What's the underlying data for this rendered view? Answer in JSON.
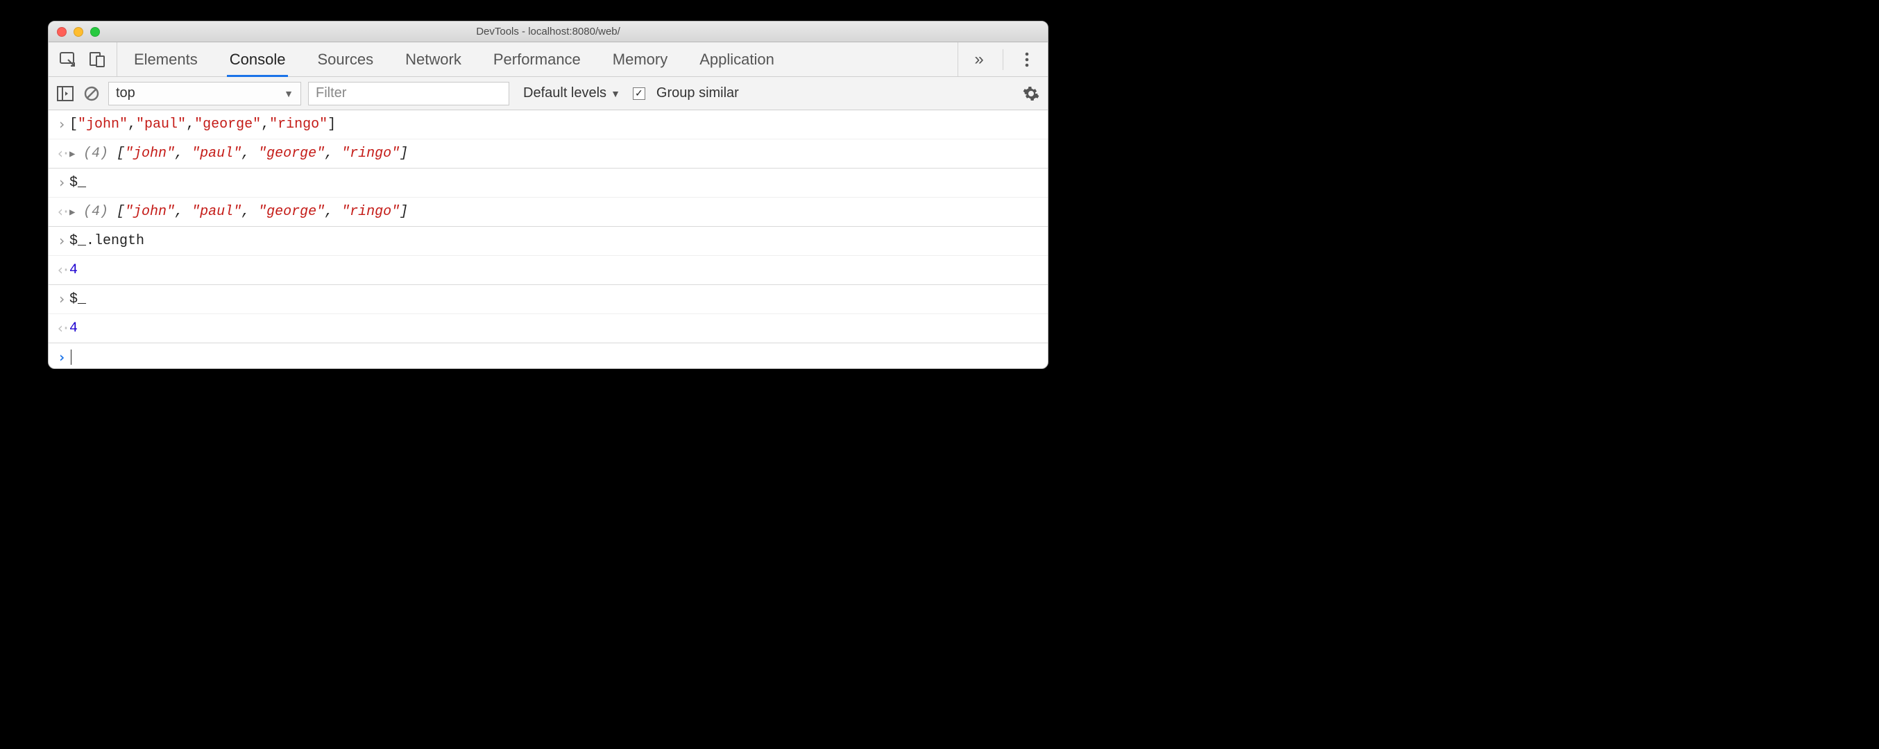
{
  "window": {
    "title": "DevTools - localhost:8080/web/"
  },
  "tabs": {
    "items": [
      {
        "label": "Elements"
      },
      {
        "label": "Console"
      },
      {
        "label": "Sources"
      },
      {
        "label": "Network"
      },
      {
        "label": "Performance"
      },
      {
        "label": "Memory"
      },
      {
        "label": "Application"
      }
    ],
    "active_index": 1,
    "more_glyph": "»"
  },
  "filter": {
    "context": "top",
    "placeholder": "Filter",
    "levels_label": "Default levels",
    "group_similar_label": "Group similar",
    "group_similar_checked": true
  },
  "console": {
    "rows": [
      {
        "kind": "input",
        "segments": [
          {
            "t": "punct",
            "v": "["
          },
          {
            "t": "str",
            "v": "\"john\""
          },
          {
            "t": "punct",
            "v": ","
          },
          {
            "t": "str",
            "v": "\"paul\""
          },
          {
            "t": "punct",
            "v": ","
          },
          {
            "t": "str",
            "v": "\"george\""
          },
          {
            "t": "punct",
            "v": ","
          },
          {
            "t": "str",
            "v": "\"ringo\""
          },
          {
            "t": "punct",
            "v": "]"
          }
        ]
      },
      {
        "kind": "output",
        "expandable": true,
        "count": "(4)",
        "italic_array": true,
        "segments": [
          {
            "t": "punct",
            "v": "["
          },
          {
            "t": "str",
            "v": "\"john\""
          },
          {
            "t": "punct",
            "v": ", "
          },
          {
            "t": "str",
            "v": "\"paul\""
          },
          {
            "t": "punct",
            "v": ", "
          },
          {
            "t": "str",
            "v": "\"george\""
          },
          {
            "t": "punct",
            "v": ", "
          },
          {
            "t": "str",
            "v": "\"ringo\""
          },
          {
            "t": "punct",
            "v": "]"
          }
        ]
      },
      {
        "kind": "input",
        "segments": [
          {
            "t": "plain",
            "v": "$_"
          }
        ]
      },
      {
        "kind": "output",
        "expandable": true,
        "count": "(4)",
        "italic_array": true,
        "segments": [
          {
            "t": "punct",
            "v": "["
          },
          {
            "t": "str",
            "v": "\"john\""
          },
          {
            "t": "punct",
            "v": ", "
          },
          {
            "t": "str",
            "v": "\"paul\""
          },
          {
            "t": "punct",
            "v": ", "
          },
          {
            "t": "str",
            "v": "\"george\""
          },
          {
            "t": "punct",
            "v": ", "
          },
          {
            "t": "str",
            "v": "\"ringo\""
          },
          {
            "t": "punct",
            "v": "]"
          }
        ]
      },
      {
        "kind": "input",
        "segments": [
          {
            "t": "plain",
            "v": "$_.length"
          }
        ]
      },
      {
        "kind": "output",
        "segments": [
          {
            "t": "num",
            "v": "4"
          }
        ]
      },
      {
        "kind": "input",
        "segments": [
          {
            "t": "plain",
            "v": "$_"
          }
        ]
      },
      {
        "kind": "output",
        "segments": [
          {
            "t": "num",
            "v": "4"
          }
        ]
      },
      {
        "kind": "prompt"
      }
    ]
  }
}
